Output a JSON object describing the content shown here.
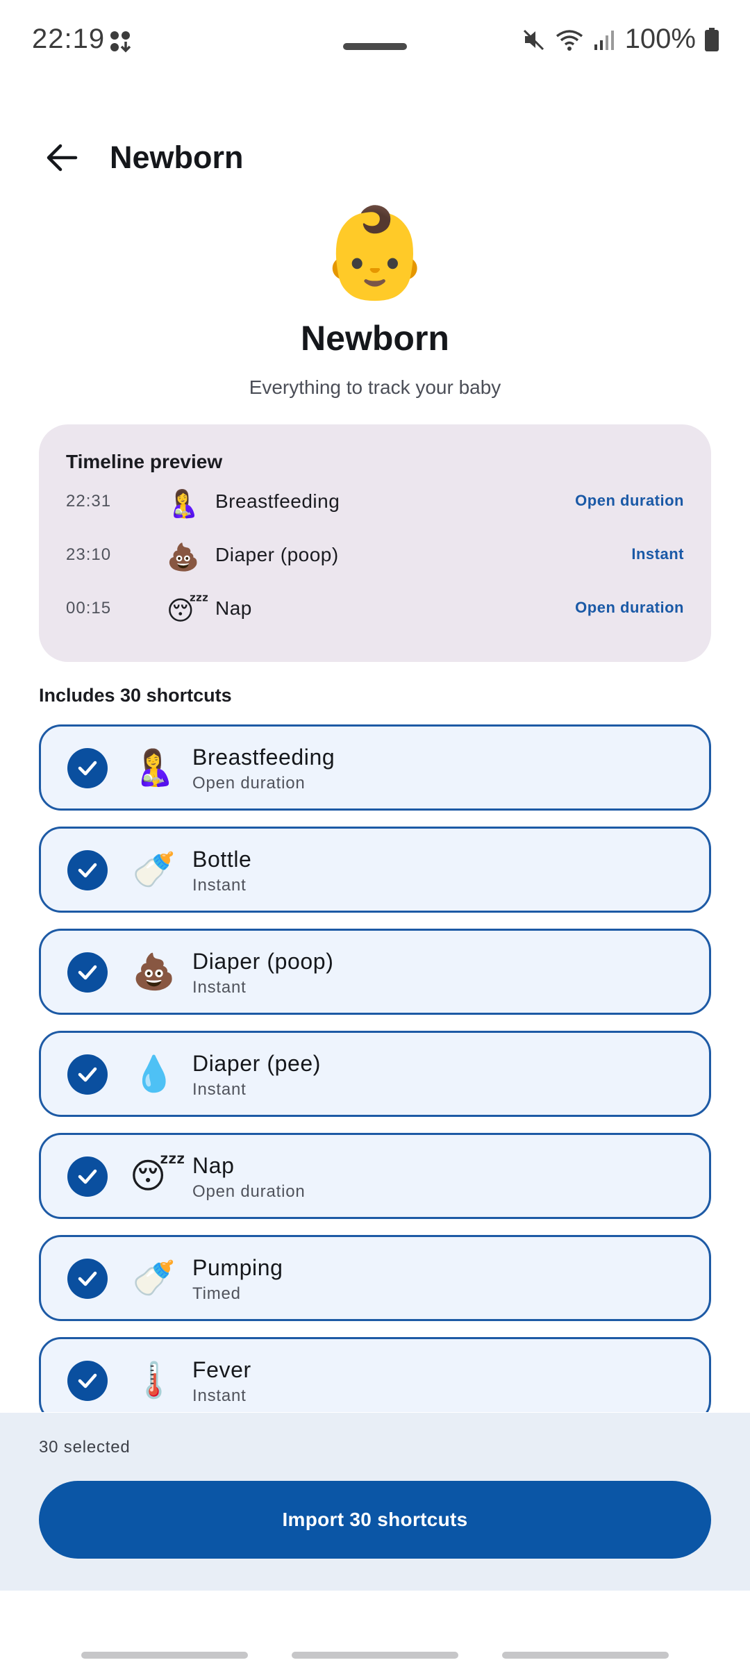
{
  "status_bar": {
    "time": "22:19",
    "battery_text": "100%",
    "icons": [
      "notification-dots-icon",
      "mute-icon",
      "wifi-icon",
      "cell-signal-icon",
      "battery-icon"
    ]
  },
  "top_bar": {
    "back_icon": "arrow-back-icon",
    "title": "Newborn"
  },
  "hero": {
    "emoji": "👶",
    "title": "Newborn",
    "subtitle": "Everything to track your baby"
  },
  "timeline_preview": {
    "title": "Timeline preview",
    "rows": [
      {
        "time": "22:31",
        "emoji": "🤱",
        "label": "Breastfeeding",
        "badge": "Open duration"
      },
      {
        "time": "23:10",
        "emoji": "💩",
        "label": "Diaper (poop)",
        "badge": "Instant"
      },
      {
        "time": "00:15",
        "emoji": "😴",
        "label": "Nap",
        "badge": "Open duration"
      }
    ]
  },
  "includes_title": "Includes 30 shortcuts",
  "shortcuts": [
    {
      "emoji": "🤱",
      "name": "Breastfeeding",
      "type": "Open duration",
      "checked": true
    },
    {
      "emoji": "🍼",
      "name": "Bottle",
      "type": "Instant",
      "checked": true
    },
    {
      "emoji": "💩",
      "name": "Diaper (poop)",
      "type": "Instant",
      "checked": true
    },
    {
      "emoji": "💧",
      "name": "Diaper (pee)",
      "type": "Instant",
      "checked": true
    },
    {
      "emoji": "😴",
      "name": "Nap",
      "type": "Open duration",
      "checked": true
    },
    {
      "emoji": "🍼",
      "name": "Pumping",
      "type": "Timed",
      "checked": true
    },
    {
      "emoji": "🌡️",
      "name": "Fever",
      "type": "Instant",
      "checked": true
    }
  ],
  "bottom": {
    "selected_count": "30 selected",
    "import_label": "Import 30 shortcuts"
  },
  "colors": {
    "accent": "#0b56a6",
    "card_bg": "#ece6ee",
    "item_bg": "#eef4fd",
    "sheet_bg": "#e8eef6"
  }
}
